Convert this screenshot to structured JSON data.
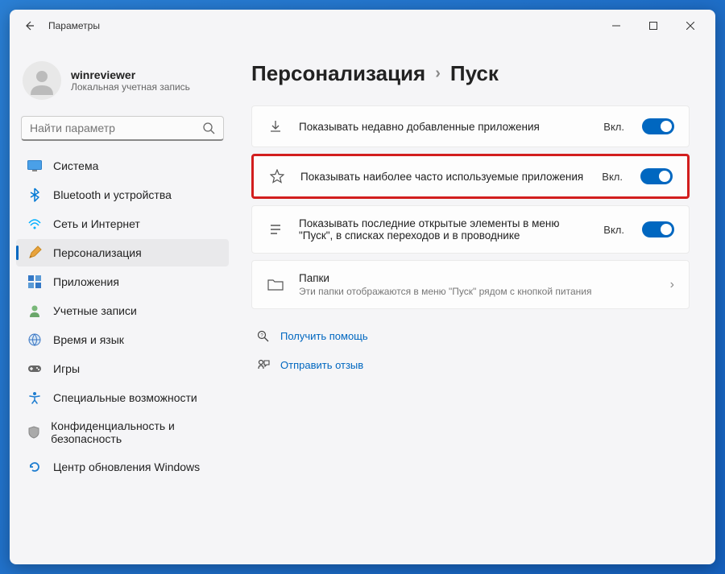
{
  "app_title": "Параметры",
  "user": {
    "name": "winreviewer",
    "account_type": "Локальная учетная запись"
  },
  "search": {
    "placeholder": "Найти параметр"
  },
  "nav": {
    "items": [
      {
        "label": "Система",
        "icon": "system-icon",
        "color": "#0078d4"
      },
      {
        "label": "Bluetooth и устройства",
        "icon": "bluetooth-icon",
        "color": "#0078d4"
      },
      {
        "label": "Сеть и Интернет",
        "icon": "network-icon",
        "color": "#00b0ff"
      },
      {
        "label": "Персонализация",
        "icon": "personalization-icon",
        "color": "#e8a33d",
        "active": true
      },
      {
        "label": "Приложения",
        "icon": "apps-icon",
        "color": "#3478c6"
      },
      {
        "label": "Учетные записи",
        "icon": "accounts-icon",
        "color": "#6aa66a"
      },
      {
        "label": "Время и язык",
        "icon": "time-language-icon",
        "color": "#3a76c4"
      },
      {
        "label": "Игры",
        "icon": "gaming-icon",
        "color": "#555"
      },
      {
        "label": "Специальные возможности",
        "icon": "accessibility-icon",
        "color": "#1e7dd0"
      },
      {
        "label": "Конфиденциальность и безопасность",
        "icon": "privacy-icon",
        "color": "#888"
      },
      {
        "label": "Центр обновления Windows",
        "icon": "windows-update-icon",
        "color": "#1e7dd0"
      }
    ]
  },
  "breadcrumb": {
    "parent": "Персонализация",
    "current": "Пуск"
  },
  "settings": [
    {
      "title": "Показывать недавно добавленные приложения",
      "state": "Вкл.",
      "toggle": true,
      "icon": "download-icon"
    },
    {
      "title": "Показывать наиболее часто используемые приложения",
      "state": "Вкл.",
      "toggle": true,
      "icon": "star-icon",
      "highlight": true
    },
    {
      "title": "Показывать последние открытые элементы в меню \"Пуск\", в списках переходов и в проводнике",
      "state": "Вкл.",
      "toggle": true,
      "icon": "list-icon"
    },
    {
      "title": "Папки",
      "sub": "Эти папки отображаются в меню \"Пуск\" рядом с кнопкой питания",
      "nav": true,
      "icon": "folder-icon"
    }
  ],
  "help": {
    "get_help": "Получить помощь",
    "feedback": "Отправить отзыв"
  }
}
